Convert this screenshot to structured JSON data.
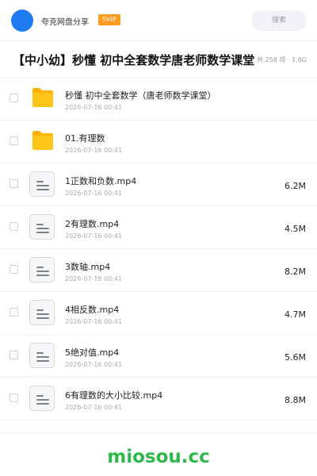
{
  "header": {
    "brand": "夸克网盘分享",
    "vip_badge": "SVIP",
    "search_placeholder": "搜索"
  },
  "share": {
    "title": "【中小幼】秒懂 初中全套数学唐老师数学课堂",
    "meta": "共 258 项 · 1.6G"
  },
  "files": [
    {
      "type": "folder",
      "name": "秒懂 初中全套数学（唐老师数学课堂）",
      "date": "2026-07-16 00:41",
      "size": ""
    },
    {
      "type": "folder",
      "name": "01.有理数",
      "date": "2026-07-16 00:41",
      "size": ""
    },
    {
      "type": "video",
      "name": "1正数和负数.mp4",
      "date": "2026-07-16 00:41",
      "size": "6.2M"
    },
    {
      "type": "video",
      "name": "2有理数.mp4",
      "date": "2026-07-16 00:41",
      "size": "4.5M"
    },
    {
      "type": "video",
      "name": "3数轴.mp4",
      "date": "2026-07-16 00:41",
      "size": "8.2M"
    },
    {
      "type": "video",
      "name": "4相反数.mp4",
      "date": "2026-07-16 00:41",
      "size": "4.7M"
    },
    {
      "type": "video",
      "name": "5绝对值.mp4",
      "date": "2026-07-16 00:41",
      "size": "5.6M"
    },
    {
      "type": "video",
      "name": "6有理数的大小比较.mp4",
      "date": "2026-07-16 00:41",
      "size": "8.8M"
    }
  ],
  "footer": {
    "watermark": "miosou.cc"
  },
  "colors": {
    "logo": "#1e7bf0",
    "vip": "#ff9a1f",
    "folder": "#ffc61a",
    "watermark": "#2eb84a"
  }
}
